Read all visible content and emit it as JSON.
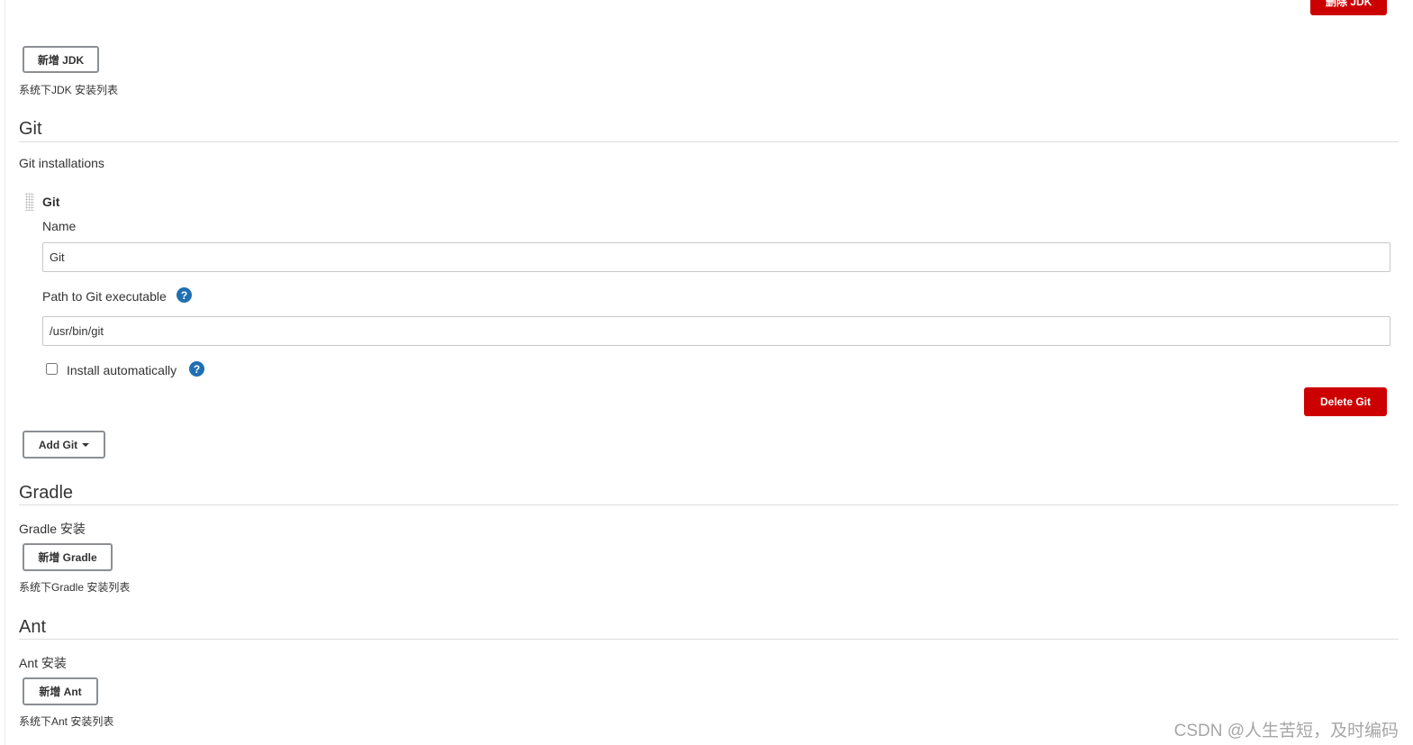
{
  "jdk": {
    "delete_button": "删除 JDK",
    "add_button": "新增 JDK",
    "hint": "系统下JDK 安装列表"
  },
  "git": {
    "section_title": "Git",
    "installations_label": "Git installations",
    "item_title": "Git",
    "name_label": "Name",
    "name_value": "Git",
    "path_label": "Path to Git executable",
    "path_value": "/usr/bin/git",
    "install_auto_label": "Install automatically",
    "install_auto_checked": false,
    "delete_button": "Delete Git",
    "add_button": "Add Git",
    "help_glyph": "?"
  },
  "gradle": {
    "section_title": "Gradle",
    "install_label": "Gradle 安装",
    "add_button": "新增 Gradle",
    "hint": "系统下Gradle 安装列表"
  },
  "ant": {
    "section_title": "Ant",
    "install_label": "Ant 安装",
    "add_button": "新增 Ant",
    "hint": "系统下Ant 安装列表"
  },
  "watermark": "CSDN @人生苦短，及时编码",
  "colors": {
    "danger": "#cc0000",
    "help": "#1f6fb2",
    "rule": "#dddddd"
  },
  "icons": {
    "help": "help-icon",
    "drag": "drag-handle-icon",
    "dropdown": "caret-down-icon"
  }
}
